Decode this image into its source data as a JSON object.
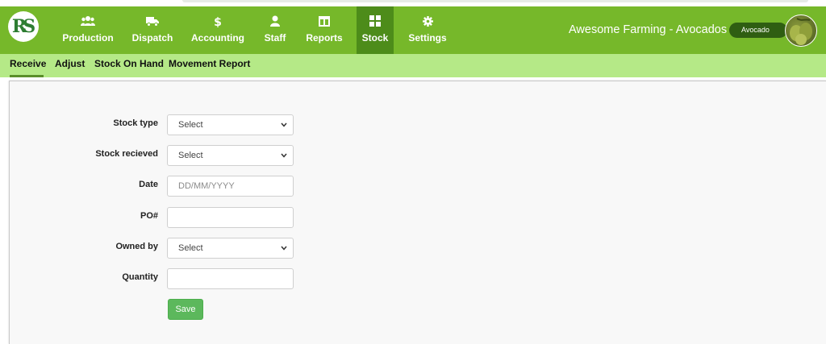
{
  "app": {
    "logo_text": "RS",
    "brand_title": "Awesome Farming - Avocados",
    "farm_selector": "Avocado"
  },
  "nav": {
    "items": [
      {
        "label": "Production",
        "icon": "users-icon"
      },
      {
        "label": "Dispatch",
        "icon": "truck-icon"
      },
      {
        "label": "Accounting",
        "icon": "dollar-icon"
      },
      {
        "label": "Staff",
        "icon": "user-icon"
      },
      {
        "label": "Reports",
        "icon": "columns-icon"
      },
      {
        "label": "Stock",
        "icon": "grid-icon",
        "active": true
      },
      {
        "label": "Settings",
        "icon": "gear-icon"
      }
    ]
  },
  "subnav": {
    "items": [
      {
        "label": "Receive",
        "active": true
      },
      {
        "label": "Adjust"
      },
      {
        "label": "Stock On Hand"
      },
      {
        "label": "Movement Report"
      }
    ]
  },
  "form": {
    "stock_type": {
      "label": "Stock type",
      "value": "Select"
    },
    "stock_received": {
      "label": "Stock recieved",
      "value": "Select"
    },
    "date": {
      "label": "Date",
      "placeholder": "DD/MM/YYYY"
    },
    "po": {
      "label": "PO#",
      "value": ""
    },
    "owned_by": {
      "label": "Owned by",
      "value": "Select"
    },
    "quantity": {
      "label": "Quantity",
      "value": ""
    },
    "save_label": "Save"
  },
  "colors": {
    "navbar": "#76b82a",
    "nav_active": "#4d8c1a",
    "subnav": "#b5e987",
    "save_button": "#5cb85c"
  }
}
